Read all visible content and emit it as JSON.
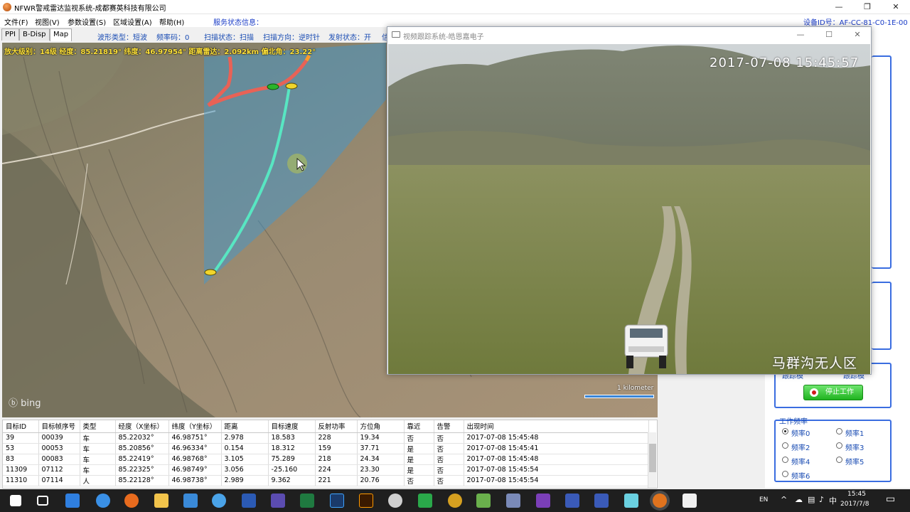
{
  "window": {
    "title": "NFWR警戒雷达监视系统-成都赛英科技有限公司",
    "controls": {
      "minimize": "—",
      "maximize": "❐",
      "close": "✕"
    }
  },
  "menu": {
    "items": [
      "文件(F)",
      "视图(V)",
      "参数设置(S)",
      "区域设置(A)",
      "帮助(H)"
    ],
    "service_info": "服务状态信息：",
    "device_id": "设备ID号：AF-CC-81-C0-1E-00"
  },
  "tabs": [
    "PPI",
    "B-Disp",
    "Map"
  ],
  "status": {
    "waveform": "波形类型：短波",
    "freq_code": "频率码：0",
    "scan_state": "扫描状态：扫描",
    "scan_dir": "扫描方向：逆时针",
    "transmit": "发射状态：开",
    "cut": "信"
  },
  "map": {
    "info": "放大级别：14级  经度：85.21819°  纬度：46.97954°  距离雷达：2.092km  偏北角：23.22°",
    "provider": "bing",
    "scale_label": "1 kilometer"
  },
  "table": {
    "columns": [
      "目标ID",
      "目标帧序号",
      "类型",
      "经度（X坐标）",
      "纬度（Y坐标）",
      "距离",
      "目标速度",
      "反射功率",
      "方位角",
      "靠近",
      "告警",
      "出现时间"
    ],
    "rows": [
      [
        "39",
        "00039",
        "车",
        "85.22032°",
        "46.98751°",
        "2.978",
        "18.583",
        "228",
        "19.34",
        "否",
        "否",
        "2017-07-08 15:45:48"
      ],
      [
        "53",
        "00053",
        "车",
        "85.20856°",
        "46.96334°",
        "0.154",
        "18.312",
        "159",
        "37.71",
        "是",
        "否",
        "2017-07-08 15:45:41"
      ],
      [
        "83",
        "00083",
        "车",
        "85.22419°",
        "46.98768°",
        "3.105",
        "75.289",
        "218",
        "24.34",
        "是",
        "否",
        "2017-07-08 15:45:48"
      ],
      [
        "11309",
        "07112",
        "车",
        "85.22325°",
        "46.98749°",
        "3.056",
        "-25.160",
        "224",
        "23.30",
        "是",
        "否",
        "2017-07-08 15:45:54"
      ],
      [
        "11310",
        "07114",
        "人",
        "85.22128°",
        "46.98738°",
        "2.989",
        "9.362",
        "221",
        "20.76",
        "否",
        "否",
        "2017-07-08 15:45:54"
      ]
    ]
  },
  "video_window": {
    "title": "视频跟踪系统-皓恩嘉电子",
    "timestamp": "2017-07-08 15:45:57",
    "location": "马群沟无人区"
  },
  "right_panel": {
    "stop_label": "停止工作",
    "freq_title": "工作频率",
    "freqs": [
      "频率0",
      "频率1",
      "频率2",
      "频率3",
      "频率4",
      "频率5",
      "频率6"
    ],
    "selected_freq": "频率0",
    "partial_left": "跟踪模",
    "partial_right": "跟踪模"
  },
  "taskbar": {
    "lang": "EN",
    "time": "15:45",
    "date": "2017/7/8"
  },
  "colors": {
    "accent_blue": "#3a6de0",
    "status_text": "#1a4cb3",
    "track_cyan": "#58e6c2",
    "track_red": "#ff5a4a",
    "coverage": "#3a9ad6",
    "stop_button": "#1fb31f"
  }
}
